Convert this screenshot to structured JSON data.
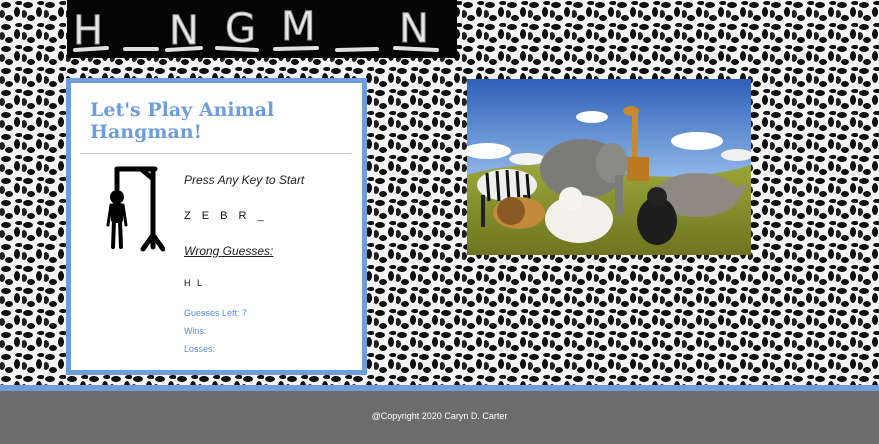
{
  "banner": {
    "letters": [
      "H",
      "_",
      "N",
      "G",
      "M",
      "_",
      "N"
    ],
    "icon": "chalk-hangman-title"
  },
  "panel": {
    "title": "Let's Play Animal Hangman!",
    "start_prompt": "Press Any Key to Start",
    "word_display": "Z E B R _",
    "wrong_label": "Wrong Guesses:",
    "wrong_letters": "H L",
    "guesses_left": "Guesses Left: 7",
    "wins": "Wins:",
    "losses": "Losses:",
    "gallows_icon": "gallows-figure-icon"
  },
  "photo": {
    "subject": "animals-group-image"
  },
  "footer": {
    "copyright": "@Copyright 2020 Caryn D. Carter"
  },
  "colors": {
    "accent": "#6d9ddb",
    "footer_bg": "#6c6c6c",
    "banner_bg": "#050505"
  }
}
